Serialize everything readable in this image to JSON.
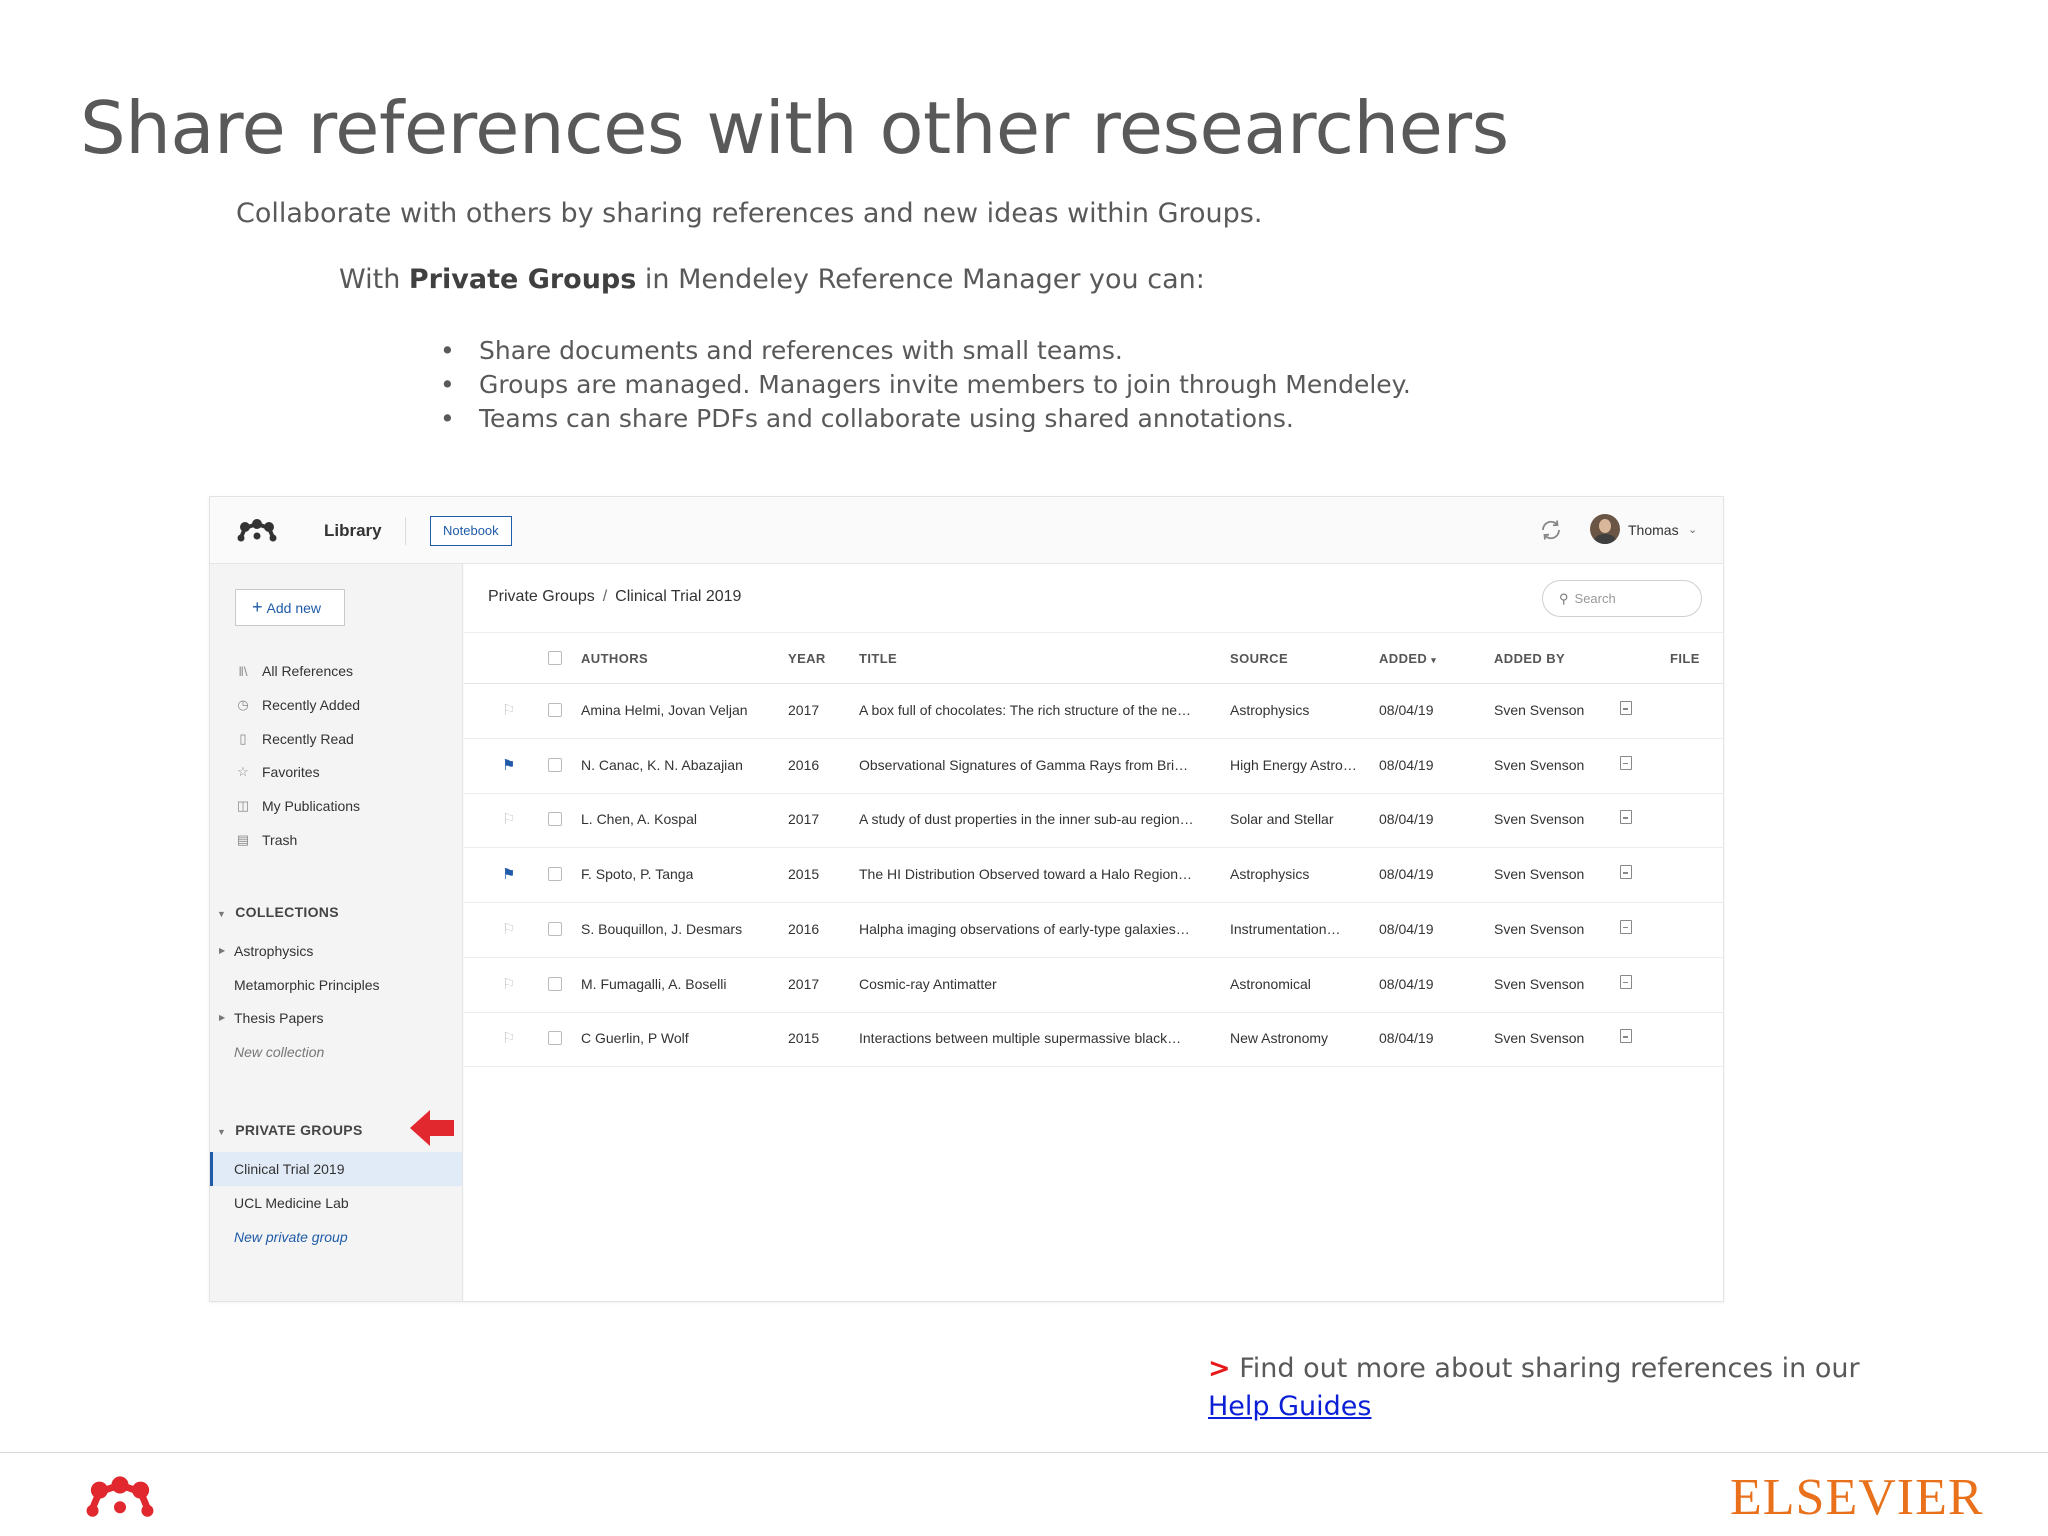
{
  "slide": {
    "title": "Share references with other researchers",
    "subtitle": "Collaborate with others by sharing references and new ideas within Groups.",
    "with_prefix": "With ",
    "with_bold": "Private Groups",
    "with_suffix": " in Mendeley Reference Manager you can:",
    "bullet_symbol": "•",
    "bullets": [
      "Share documents and references with small teams.",
      "Groups are managed. Managers invite members to join through Mendeley.",
      "Teams can share PDFs and collaborate using shared annotations."
    ],
    "find_more_marker": ">",
    "find_more_text": " Find out more about sharing references in our",
    "help_link": "Help Guides",
    "publisher": "ELSEVIER"
  },
  "colors": {
    "accent": "#1f5ba8",
    "arrow": "#e0282e",
    "publisher": "#e9711c",
    "brand_logo": "#e0282e"
  },
  "app": {
    "tabs": {
      "library": "Library",
      "notebook": "Notebook"
    },
    "user": {
      "name": "Thomas"
    },
    "sidebar": {
      "add_new": "Add new",
      "nav": [
        {
          "icon": "library-icon",
          "label": "All References"
        },
        {
          "icon": "clock-icon",
          "label": "Recently Added"
        },
        {
          "icon": "bookmark-icon",
          "label": "Recently Read"
        },
        {
          "icon": "star-icon",
          "label": "Favorites"
        },
        {
          "icon": "publications-icon",
          "label": "My Publications"
        },
        {
          "icon": "trash-icon",
          "label": "Trash"
        }
      ],
      "collections_heading": "COLLECTIONS",
      "collections": [
        {
          "label": "Astrophysics",
          "expandable": true
        },
        {
          "label": "Metamorphic Principles",
          "expandable": false
        },
        {
          "label": "Thesis Papers",
          "expandable": true
        }
      ],
      "new_collection": "New collection",
      "groups_heading": "PRIVATE GROUPS",
      "groups": [
        "Clinical Trial 2019",
        "UCL Medicine Lab"
      ],
      "active_group": "Clinical Trial 2019",
      "new_group": "New private group"
    },
    "breadcrumb": {
      "parent": "Private Groups",
      "separator": "/",
      "current": "Clinical Trial 2019"
    },
    "search": {
      "placeholder": "Search"
    },
    "table": {
      "headers": {
        "authors": "AUTHORS",
        "year": "YEAR",
        "title": "TITLE",
        "source": "SOURCE",
        "added": "ADDED",
        "sort_indicator": "▾",
        "added_by": "ADDED BY",
        "file": "FILE"
      },
      "rows": [
        {
          "flagged": false,
          "authors": "Amina Helmi, Jovan Veljan",
          "year": "2017",
          "title": "A box full of chocolates: The rich structure of the ne…",
          "source": "Astrophysics",
          "added": "08/04/19",
          "added_by": "Sven Svenson"
        },
        {
          "flagged": true,
          "authors": "N. Canac, K. N. Abazajian",
          "year": "2016",
          "title": "Observational Signatures of Gamma Rays from Bri…",
          "source": "High Energy Astro…",
          "added": "08/04/19",
          "added_by": "Sven Svenson"
        },
        {
          "flagged": false,
          "authors": "L. Chen, A. Kospal",
          "year": "2017",
          "title": "A study of dust properties in the inner sub-au region…",
          "source": "Solar and Stellar",
          "added": "08/04/19",
          "added_by": "Sven Svenson"
        },
        {
          "flagged": true,
          "authors": "F. Spoto, P. Tanga",
          "year": "2015",
          "title": "The HI Distribution Observed toward a Halo Region…",
          "source": "Astrophysics",
          "added": "08/04/19",
          "added_by": "Sven Svenson"
        },
        {
          "flagged": false,
          "authors": "S. Bouquillon, J. Desmars",
          "year": "2016",
          "title": "Halpha imaging observations of early-type galaxies…",
          "source": "Instrumentation…",
          "added": "08/04/19",
          "added_by": "Sven Svenson"
        },
        {
          "flagged": false,
          "authors": "M. Fumagalli, A. Boselli",
          "year": "2017",
          "title": "Cosmic-ray Antimatter",
          "source": "Astronomical",
          "added": "08/04/19",
          "added_by": "Sven Svenson"
        },
        {
          "flagged": false,
          "authors": "C Guerlin, P Wolf",
          "year": "2015",
          "title": "Interactions between multiple supermassive black…",
          "source": "New Astronomy",
          "added": "08/04/19",
          "added_by": "Sven Svenson"
        }
      ]
    }
  }
}
